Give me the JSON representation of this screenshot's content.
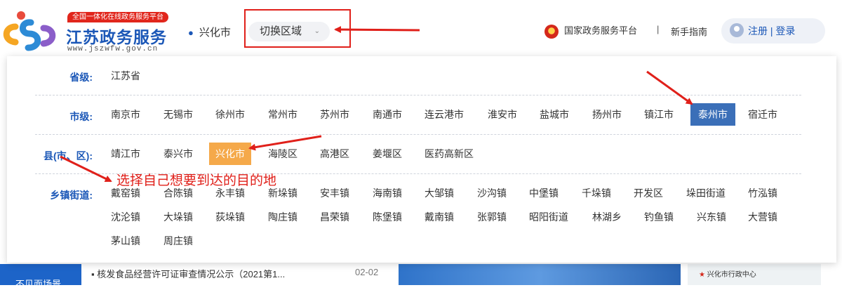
{
  "header": {
    "logo_tag": "全国一体化在线政务服务平台",
    "logo_name": "江苏政务服务",
    "logo_url": "www.jszwfw.gov.cn",
    "current_city": "兴化市",
    "switch_label": "切换区域",
    "gov_platform": "国家政务服务平台",
    "separator": "|",
    "guide": "新手指南",
    "register": "注册",
    "auth_sep": "|",
    "login": "登录"
  },
  "panel": {
    "province": {
      "label": "省级:",
      "items": [
        "江苏省"
      ]
    },
    "city": {
      "label": "市级:",
      "items": [
        "南京市",
        "无锡市",
        "徐州市",
        "常州市",
        "苏州市",
        "南通市",
        "连云港市",
        "淮安市",
        "盐城市",
        "扬州市",
        "镇江市",
        "泰州市",
        "宿迁市"
      ],
      "selected": "泰州市"
    },
    "county": {
      "label": "县(市、区):",
      "items": [
        "靖江市",
        "泰兴市",
        "兴化市",
        "海陵区",
        "高港区",
        "姜堰区",
        "医药高新区"
      ],
      "selected": "兴化市"
    },
    "town": {
      "label": "乡镇街道:",
      "items": [
        "戴窑镇",
        "合陈镇",
        "永丰镇",
        "新垛镇",
        "安丰镇",
        "海南镇",
        "大邹镇",
        "沙沟镇",
        "中堡镇",
        "千垛镇",
        "开发区",
        "垛田街道",
        "竹泓镇",
        "沈沦镇",
        "大垛镇",
        "荻垛镇",
        "陶庄镇",
        "昌荣镇",
        "陈堡镇",
        "戴南镇",
        "张郭镇",
        "昭阳街道",
        "林湖乡",
        "钓鱼镇",
        "兴东镇",
        "大营镇",
        "茅山镇",
        "周庄镇"
      ]
    }
  },
  "annotation": {
    "text": "选择自己想要到达的目的地"
  },
  "background_page": {
    "left_tab": "不见面场景",
    "news_item": "核发食品经营许可证审查情况公示（2021第1...",
    "news_date": "02-02",
    "map_label": "兴化市行政中心"
  },
  "colors": {
    "brand_blue": "#1b57b7",
    "selected_city_bg": "#3b6fb8",
    "selected_county_bg": "#f5a94a",
    "annotation_red": "#e0201a"
  }
}
